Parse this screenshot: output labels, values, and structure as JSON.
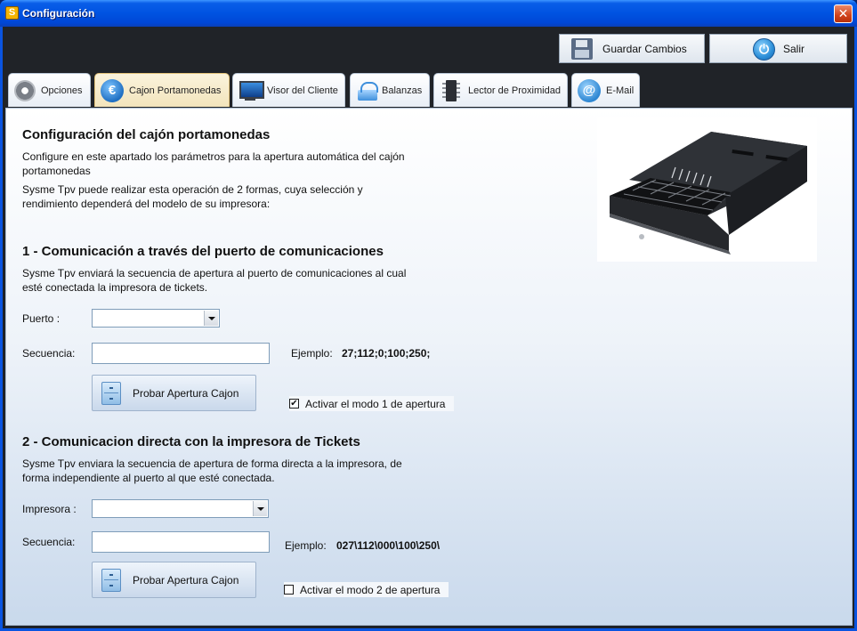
{
  "window": {
    "app_icon": "S",
    "title": "Configuración",
    "close_glyph": "✕"
  },
  "toolbar": {
    "save_label": "Guardar Cambios",
    "exit_label": "Salir",
    "save_icon": "floppy-disk-icon",
    "exit_icon": "power-icon"
  },
  "tabs": [
    {
      "label": "Opciones",
      "icon": "gear-icon",
      "active": false
    },
    {
      "label": "Cajon Portamonedas",
      "icon": "euro-icon",
      "active": true
    },
    {
      "label": "Visor del Cliente",
      "icon": "monitor-icon",
      "active": false
    },
    {
      "label": "Balanzas",
      "icon": "scale-icon",
      "active": false
    },
    {
      "label": "Lector de Proximidad",
      "icon": "chip-icon",
      "active": false
    },
    {
      "label": "E-Mail",
      "icon": "at-icon",
      "active": false
    }
  ],
  "intro": {
    "title": "Configuración del cajón portamonedas",
    "line1": "Configure en este apartado los parámetros para la apertura automática del cajón",
    "line2": "portamonedas",
    "line3": "Sysme Tpv puede realizar esta operación de 2 formas, cuya selección y",
    "line4": "rendimiento dependerá del modelo de su impresora:"
  },
  "section1": {
    "title": "1 - Comunicación a través del puerto de comunicaciones",
    "line1": "Sysme Tpv enviará la secuencia de apertura al puerto de comunicaciones al cual",
    "line2": "esté conectada la impresora de tickets.",
    "port_label": "Puerto :",
    "port_value": "",
    "sequence_label": "Secuencia:",
    "sequence_value": "",
    "example_label": "Ejemplo:",
    "example_value": "27;112;0;100;250;",
    "test_button": "Probar Apertura Cajon",
    "activate_label": "Activar el modo 1 de apertura",
    "activate_checked": true
  },
  "section2": {
    "title": "2 - Comunicacion directa con la impresora de Tickets",
    "line1": "Sysme Tpv enviara la secuencia de apertura de forma directa a la impresora, de",
    "line2": "forma independiente al puerto al que esté conectada.",
    "printer_label": "Impresora :",
    "printer_value": "",
    "sequence_label": "Secuencia:",
    "sequence_value": "",
    "example_label": "Ejemplo:",
    "example_value": "027\\112\\000\\100\\250\\",
    "test_button": "Probar Apertura Cajon",
    "activate_label": "Activar el modo 2 de apertura",
    "activate_checked": false
  },
  "colors": {
    "titlebar": "#0053e1",
    "toolbar_bg": "#202328",
    "active_tab": "#f2e4bc",
    "panel_gradient_bottom": "#c9d9ec"
  }
}
